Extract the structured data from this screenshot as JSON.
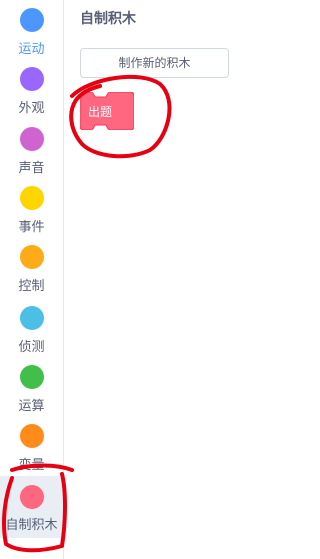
{
  "sidebar": {
    "categories": [
      {
        "label": "运动",
        "color": "#4c97ff",
        "selected": true
      },
      {
        "label": "外观",
        "color": "#9966ff"
      },
      {
        "label": "声音",
        "color": "#cf63cf"
      },
      {
        "label": "事件",
        "color": "#ffd500"
      },
      {
        "label": "控制",
        "color": "#ffab19"
      },
      {
        "label": "侦测",
        "color": "#4cbfe6"
      },
      {
        "label": "运算",
        "color": "#40bf4a"
      },
      {
        "label": "变量",
        "color": "#ff8c1a"
      },
      {
        "label": "自制积木",
        "color": "#ff6680",
        "active": true
      }
    ]
  },
  "palette": {
    "title": "自制积木",
    "make_block_label": "制作新的积木",
    "blocks": [
      {
        "label": "出题",
        "color": "#ff6680"
      }
    ]
  },
  "annotations": {
    "color": "#e60012"
  }
}
